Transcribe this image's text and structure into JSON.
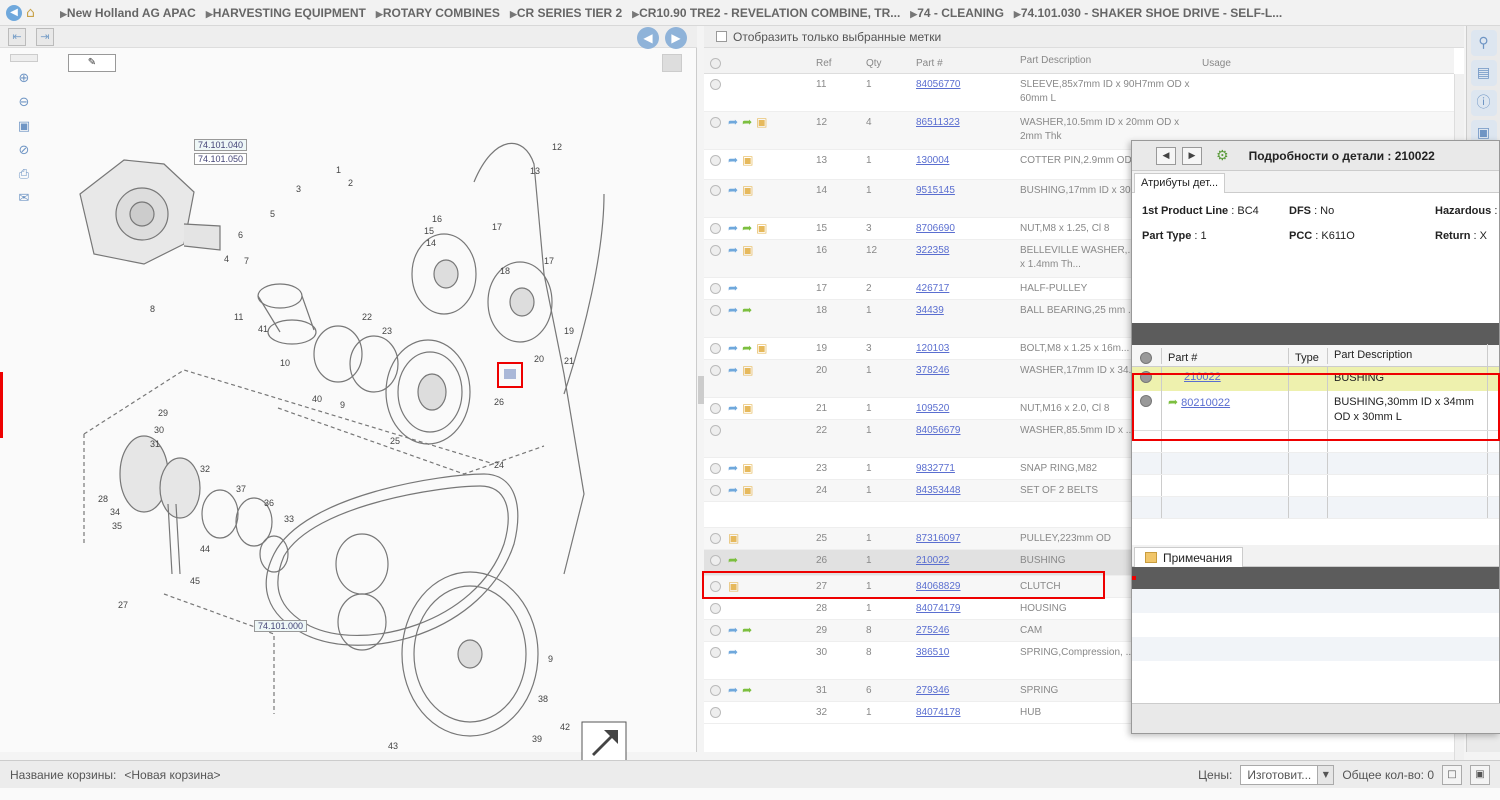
{
  "breadcrumb": [
    "New Holland AG APAC",
    "HARVESTING EQUIPMENT",
    "ROTARY COMBINES",
    "CR SERIES TIER 2",
    "CR10.90 TRE2 - REVELATION COMBINE, TR...",
    "74 - CLEANING",
    "74.101.030 - SHAKER SHOE DRIVE - SELF-L..."
  ],
  "diagram": {
    "callouts": [
      "74.101.040",
      "74.101.050",
      "74.101.000"
    ],
    "labels": [
      "2",
      "1",
      "4",
      "7",
      "8",
      "11",
      "41",
      "10",
      "40",
      "9",
      "6",
      "5",
      "3",
      "12",
      "13",
      "16",
      "15",
      "14",
      "17",
      "18",
      "17",
      "19",
      "21",
      "20",
      "22",
      "23",
      "25",
      "26",
      "29",
      "30",
      "31",
      "32",
      "28",
      "34",
      "35",
      "37",
      "36",
      "33",
      "44",
      "45",
      "27",
      "24",
      "9",
      "38",
      "39",
      "43",
      "42"
    ]
  },
  "parts_filter": {
    "label": "Отобразить только выбранные метки"
  },
  "parts_table": {
    "headers": {
      "ref": "Ref",
      "qty": "Qty",
      "part": "Part #",
      "desc": "Part Description",
      "usage": "Usage"
    },
    "rows": [
      {
        "ref": "11",
        "qty": "1",
        "part": "84056770",
        "desc": "SLEEVE,85x7mm ID x 90H7mm OD x 60mm L",
        "icons": []
      },
      {
        "ref": "12",
        "qty": "4",
        "part": "86511323",
        "desc": "WASHER,10.5mm ID x 20mm OD x 2mm Thk",
        "icons": [
          "blue",
          "green",
          "box"
        ]
      },
      {
        "ref": "13",
        "qty": "1",
        "part": "130004",
        "desc": "COTTER PIN,2.9mm OD x ... OAL",
        "icons": [
          "blue",
          "box"
        ]
      },
      {
        "ref": "14",
        "qty": "1",
        "part": "9515145",
        "desc": "BUSHING,17mm ID x 30... 29mm L",
        "icons": [
          "blue",
          "box"
        ]
      },
      {
        "ref": "15",
        "qty": "3",
        "part": "8706690",
        "desc": "NUT,M8 x 1.25, Cl 8",
        "icons": [
          "blue",
          "green",
          "box"
        ]
      },
      {
        "ref": "16",
        "qty": "12",
        "part": "322358",
        "desc": "BELLEVILLE WASHER,... x 18mm OD x 1.4mm Th...",
        "icons": [
          "blue",
          "box"
        ]
      },
      {
        "ref": "17",
        "qty": "2",
        "part": "426717",
        "desc": "HALF-PULLEY",
        "icons": [
          "blue"
        ]
      },
      {
        "ref": "18",
        "qty": "1",
        "part": "34439",
        "desc": "BALL BEARING,25 mm ... OD x 15 mm",
        "icons": [
          "blue",
          "green"
        ]
      },
      {
        "ref": "19",
        "qty": "3",
        "part": "120103",
        "desc": "BOLT,M8 x 1.25 x 16m...",
        "icons": [
          "blue",
          "green",
          "box"
        ]
      },
      {
        "ref": "20",
        "qty": "1",
        "part": "378246",
        "desc": "WASHER,17mm ID x 34... 3mm Thk",
        "icons": [
          "blue",
          "box"
        ]
      },
      {
        "ref": "21",
        "qty": "1",
        "part": "109520",
        "desc": "NUT,M16 x 2.0, Cl 8",
        "icons": [
          "blue",
          "box"
        ]
      },
      {
        "ref": "22",
        "qty": "1",
        "part": "84056679",
        "desc": "WASHER,85.5mm ID x ... 2mm Thk",
        "icons": []
      },
      {
        "ref": "23",
        "qty": "1",
        "part": "9832771",
        "desc": "SNAP RING,M82",
        "icons": [
          "blue",
          "box"
        ]
      },
      {
        "ref": "24",
        "qty": "1",
        "part": "84353448",
        "desc": "SET OF 2 BELTS",
        "icons": [
          "blue",
          "box"
        ]
      },
      {
        "ref": "",
        "qty": "",
        "part": "",
        "desc": "",
        "icons": []
      },
      {
        "ref": "25",
        "qty": "1",
        "part": "87316097",
        "desc": "PULLEY,223mm OD",
        "icons": [
          "box"
        ]
      },
      {
        "ref": "26",
        "qty": "1",
        "part": "210022",
        "desc": "BUSHING",
        "icons": [
          "green"
        ],
        "selected": true
      },
      {
        "ref": "27",
        "qty": "1",
        "part": "84068829",
        "desc": "CLUTCH",
        "icons": [
          "box"
        ]
      },
      {
        "ref": "28",
        "qty": "1",
        "part": "84074179",
        "desc": "HOUSING",
        "icons": []
      },
      {
        "ref": "29",
        "qty": "8",
        "part": "275246",
        "desc": "CAM",
        "icons": [
          "blue",
          "green"
        ]
      },
      {
        "ref": "30",
        "qty": "8",
        "part": "386510",
        "desc": "SPRING,Compression, ... 13.2mm L",
        "icons": [
          "blue"
        ]
      },
      {
        "ref": "31",
        "qty": "6",
        "part": "279346",
        "desc": "SPRING",
        "icons": [
          "blue",
          "green"
        ]
      },
      {
        "ref": "32",
        "qty": "1",
        "part": "84074178",
        "desc": "HUB",
        "icons": []
      }
    ]
  },
  "popup": {
    "title": "Подробности о детали : 210022",
    "attr_tab": "Атрибуты дет...",
    "attributes": {
      "product_line_label": "1st Product Line",
      "product_line_value": ": BC4",
      "dfs_label": "DFS",
      "dfs_value": ": No",
      "hazardous_label": "Hazardous",
      "hazardous_value": ":",
      "part_type_label": "Part Type",
      "part_type_value": ": 1",
      "pcc_label": "PCC",
      "pcc_value": ": K611O",
      "return_label": "Return",
      "return_value": ": X"
    },
    "subtable": {
      "headers": {
        "part": "Part #",
        "type": "Type",
        "desc": "Part Description"
      },
      "rows": [
        {
          "part": "210022",
          "type": "",
          "desc": "BUSHING",
          "highlight": true
        },
        {
          "part": "80210022",
          "type": "",
          "desc": "BUSHING,30mm ID x 34mm OD x 30mm L",
          "highlight": false
        }
      ]
    },
    "notes_tab": "Примечания"
  },
  "footer": {
    "basket_label": "Название корзины:",
    "basket_value": "<Новая корзина>",
    "prices_label": "Цены:",
    "prices_value": "Изготовит...",
    "total_label": "Общее кол-во: 0"
  },
  "colors": {
    "highlight_red": "#e00000",
    "link_blue": "#5a6ed0",
    "selected_row": "#e1e1e1",
    "popup_highlight": "#eef1ae"
  }
}
